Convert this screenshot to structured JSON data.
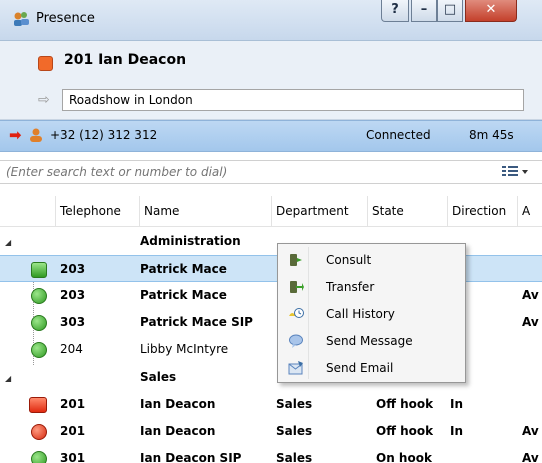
{
  "window": {
    "title": "Presence",
    "help_label": "?",
    "minimize_label": "–",
    "maximize_label": "□",
    "close_label": "✕"
  },
  "presence": {
    "user_label": "201 Ian Deacon",
    "status_color": "#f16a2a",
    "note_value": "Roadshow in London"
  },
  "call": {
    "number": "+32 (12) 312 312",
    "status": "Connected",
    "duration": "8m 45s"
  },
  "search": {
    "placeholder": "(Enter search text or number to dial)"
  },
  "columns": [
    "Telephone",
    "Name",
    "Department",
    "State",
    "Direction",
    "A"
  ],
  "groups": [
    {
      "name": "Administration",
      "rows": [
        {
          "telephone": "203",
          "name": "Patrick Mace",
          "department": "",
          "state": "",
          "direction": "",
          "extra": "",
          "icon": "green-square-icon",
          "selected": true
        },
        {
          "telephone": "203",
          "name": "Patrick Mace",
          "department": "",
          "state": "",
          "direction": "",
          "extra": "Av",
          "icon": "green-circle-icon",
          "selected": false
        },
        {
          "telephone": "303",
          "name": "Patrick Mace SIP",
          "department": "",
          "state": "",
          "direction": "",
          "extra": "Av",
          "icon": "green-circle-icon",
          "selected": false
        },
        {
          "telephone": "204",
          "name": "Libby McIntyre",
          "department": "",
          "state": "",
          "direction": "",
          "extra": "",
          "icon": "green-circle-icon",
          "selected": false
        }
      ]
    },
    {
      "name": "Sales",
      "rows": [
        {
          "telephone": "201",
          "name": "Ian Deacon",
          "department": "Sales",
          "state": "Off hook",
          "direction": "In",
          "extra": "",
          "icon": "red-phone-icon",
          "selected": false
        },
        {
          "telephone": "201",
          "name": "Ian Deacon",
          "department": "Sales",
          "state": "Off hook",
          "direction": "In",
          "extra": "Av",
          "icon": "red-phone-circle-icon",
          "selected": false
        },
        {
          "telephone": "301",
          "name": "Ian Deacon SIP",
          "department": "Sales",
          "state": "On hook",
          "direction": "",
          "extra": "Av",
          "icon": "green-circle-icon",
          "selected": false
        }
      ]
    }
  ],
  "context_menu": [
    {
      "label": "Consult",
      "icon": "consult-icon"
    },
    {
      "label": "Transfer",
      "icon": "transfer-icon"
    },
    {
      "label": "Call History",
      "icon": "call-history-icon"
    },
    {
      "label": "Send Message",
      "icon": "send-message-icon"
    },
    {
      "label": "Send Email",
      "icon": "send-email-icon"
    }
  ]
}
